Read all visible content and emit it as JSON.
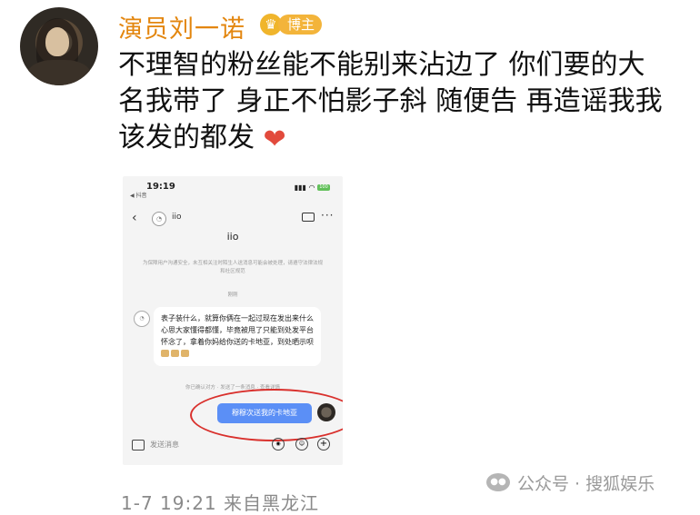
{
  "post": {
    "username": "演员刘一诺",
    "badge_label": "博主",
    "text": "不理智的粉丝能不能别来沾边了 你们要的大\n名我带了 身正不怕影子斜 随便告 再造谣我我\n该发的都发",
    "timestamp": "1-7 19:21",
    "location": "来自黑龙江"
  },
  "screenshot": {
    "status_time": "19:19",
    "status_sub": "◀ 抖音",
    "battery": "100",
    "chat_title": "iio",
    "notice": "为保障用户沟通安全，未互相关注时陌生人送消息可能会被处理，请遵守法律法规和社区规范",
    "timestamp": "刚刚",
    "incoming_message": "表子装什么，就算你俩在一起过现在发出来什么心思大家懂得都懂，毕竟被甩了只能到处发平台怀念了，拿着你妈给你送的卡地亚，到处晒示呗",
    "system_note": "你已确认对方 · 发送了一条消息 · 查看详情",
    "outgoing_message": "穆穆次送我的卡地亚",
    "input_placeholder": "发送消息"
  },
  "watermark": {
    "text": "公众号 · 搜狐娱乐"
  },
  "colors": {
    "username": "#e3860e",
    "badge": "#f3b43a",
    "heart": "#e24a3c",
    "outgoing_bubble": "#5b8ff6",
    "highlight_ring": "#d9302c"
  }
}
